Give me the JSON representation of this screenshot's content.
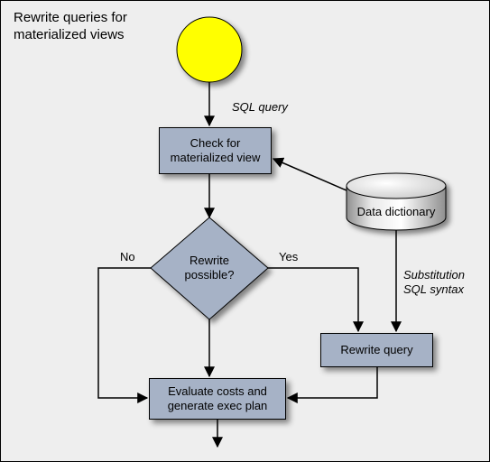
{
  "title": "Rewrite queries for\nmaterialized views",
  "labels": {
    "sql_query": "SQL query",
    "no": "No",
    "yes": "Yes",
    "substitution": "Substitution\nSQL syntax"
  },
  "nodes": {
    "check": "Check for\nmaterialized view",
    "rewrite_possible": "Rewrite\npossible?",
    "data_dictionary": "Data dictionary",
    "rewrite_query": "Rewrite query",
    "evaluate": "Evaluate costs and\ngenerate exec plan"
  }
}
